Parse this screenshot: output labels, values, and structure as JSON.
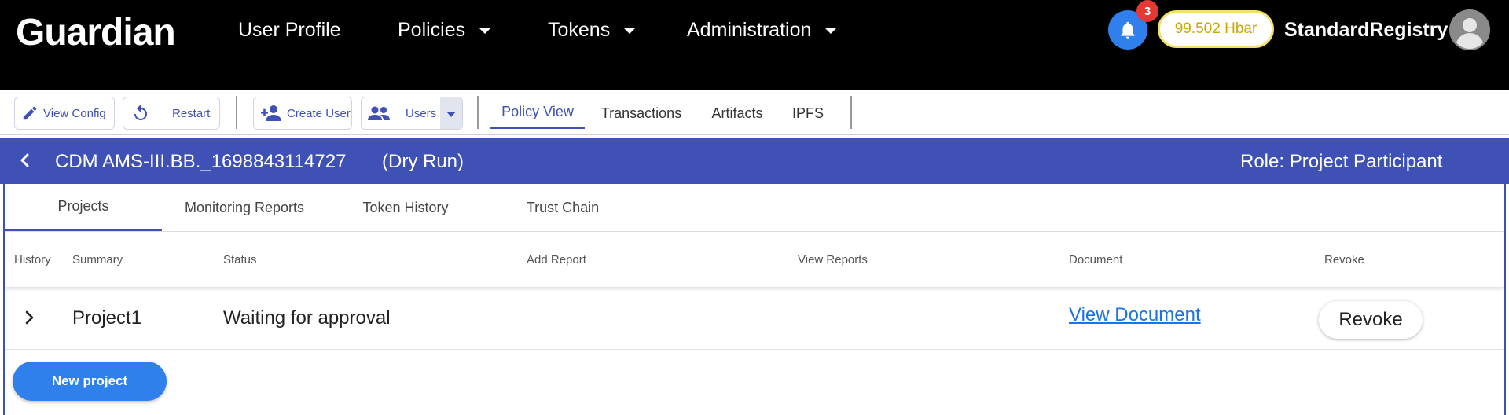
{
  "header": {
    "logo": "Guardian",
    "nav": [
      {
        "label": "User Profile"
      },
      {
        "label": "Policies"
      },
      {
        "label": "Tokens"
      },
      {
        "label": "Administration"
      }
    ],
    "notifications_count": "3",
    "balance": "99.502 Hbar",
    "username": "StandardRegistry"
  },
  "toolbar": {
    "view_config": "View Config",
    "restart": "Restart",
    "create_user": "Create User",
    "users": "Users",
    "tabs": [
      "Policy View",
      "Transactions",
      "Artifacts",
      "IPFS"
    ],
    "active_tab": "Policy View"
  },
  "policy": {
    "title": "CDM AMS-III.BB._1698843114727",
    "mode": "(Dry Run)",
    "role": "Role: Project Participant"
  },
  "subtabs": [
    "Projects",
    "Monitoring Reports",
    "Token History",
    "Trust Chain"
  ],
  "active_subtab": "Projects",
  "table": {
    "columns": [
      "History",
      "Summary",
      "Status",
      "Add Report",
      "View Reports",
      "Document",
      "Revoke"
    ],
    "rows": [
      {
        "summary": "Project1",
        "status": "Waiting for approval",
        "add_report": "",
        "view_reports": "",
        "document": "View Document",
        "revoke": "Revoke"
      }
    ]
  },
  "new_project_button": "New project",
  "colors": {
    "header_bg": "#000000",
    "primary": "#3f51b5",
    "accent_blue": "#2f80ed",
    "badge_red": "#e53935",
    "balance_text": "#c9a800"
  }
}
